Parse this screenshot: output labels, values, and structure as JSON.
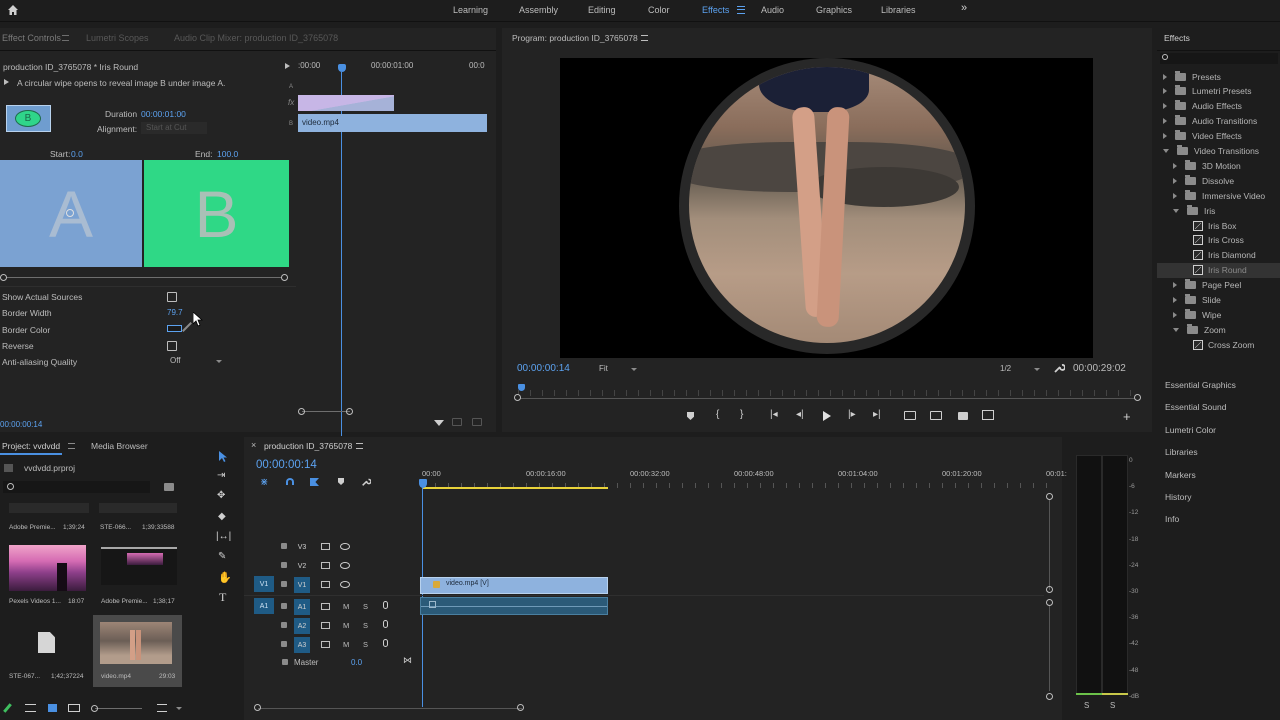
{
  "top_nav": {
    "home_icon": "home-icon",
    "items": [
      "Learning",
      "Assembly",
      "Editing",
      "Color",
      "Effects",
      "Audio",
      "Graphics",
      "Libraries"
    ],
    "active": "Effects",
    "more_icon": "double-chevron-right-icon"
  },
  "effect_controls": {
    "tabs": [
      "Effect Controls",
      "Lumetri Scopes",
      "Audio Clip Mixer: production ID_3765078"
    ],
    "clip_title": "production ID_3765078 * Iris Round",
    "description": "A circular wipe opens to reveal image B under image A.",
    "duration_label": "Duration",
    "duration_value": "00:00:01:00",
    "alignment_label": "Alignment:",
    "alignment_value": "Start at Cut",
    "start_label": "Start:",
    "start_value": "0.0",
    "end_label": "End:",
    "end_value": "100.0",
    "preview_a": "A",
    "preview_b": "B",
    "thumb_letter": "B",
    "props": [
      {
        "label": "Show Actual Sources"
      },
      {
        "label": "Border Width",
        "value": "79.7"
      },
      {
        "label": "Border Color"
      },
      {
        "label": "Reverse"
      },
      {
        "label": "Anti-aliasing Quality",
        "value": "Off"
      }
    ],
    "timecode": "00:00:00:14",
    "mini_timeline": {
      "t0": ":00:00",
      "t1": "00:00:01:00",
      "t2": "00:0",
      "track_a": "A",
      "track_b": "B",
      "clip": "video.mp4"
    }
  },
  "program": {
    "title": "Program: production ID_3765078",
    "timecode": "00:00:00:14",
    "fit": "Fit",
    "resolution": "1/2",
    "duration": "00:00:29:02",
    "border_color": "#2a2a2a"
  },
  "effects_panel": {
    "title": "Effects",
    "tree": [
      {
        "label": "Presets",
        "level": 0,
        "type": "folder",
        "open": false
      },
      {
        "label": "Lumetri Presets",
        "level": 0,
        "type": "folder",
        "open": false
      },
      {
        "label": "Audio Effects",
        "level": 0,
        "type": "folder",
        "open": false
      },
      {
        "label": "Audio Transitions",
        "level": 0,
        "type": "folder",
        "open": false
      },
      {
        "label": "Video Effects",
        "level": 0,
        "type": "folder",
        "open": false
      },
      {
        "label": "Video Transitions",
        "level": 0,
        "type": "folder",
        "open": true
      },
      {
        "label": "3D Motion",
        "level": 1,
        "type": "folder",
        "open": false
      },
      {
        "label": "Dissolve",
        "level": 1,
        "type": "folder",
        "open": false
      },
      {
        "label": "Immersive Video",
        "level": 1,
        "type": "folder",
        "open": false
      },
      {
        "label": "Iris",
        "level": 1,
        "type": "folder",
        "open": true
      },
      {
        "label": "Iris Box",
        "level": 2,
        "type": "fx"
      },
      {
        "label": "Iris Cross",
        "level": 2,
        "type": "fx"
      },
      {
        "label": "Iris Diamond",
        "level": 2,
        "type": "fx"
      },
      {
        "label": "Iris Round",
        "level": 2,
        "type": "fx",
        "selected": true
      },
      {
        "label": "Page Peel",
        "level": 1,
        "type": "folder",
        "open": false
      },
      {
        "label": "Slide",
        "level": 1,
        "type": "folder",
        "open": false
      },
      {
        "label": "Wipe",
        "level": 1,
        "type": "folder",
        "open": false
      },
      {
        "label": "Zoom",
        "level": 1,
        "type": "folder",
        "open": true
      },
      {
        "label": "Cross Zoom",
        "level": 2,
        "type": "fx"
      }
    ],
    "panels": [
      "Essential Graphics",
      "Essential Sound",
      "Lumetri Color",
      "Libraries",
      "Markers",
      "History",
      "Info"
    ]
  },
  "project": {
    "tabs": [
      "Project: vvdvdd",
      "Media Browser"
    ],
    "file": "vvdvdd.prproj",
    "items": [
      {
        "name": "Adobe Premie...",
        "duration": "1;39;24"
      },
      {
        "name": "STE-066...",
        "duration": "1;39;33588"
      },
      {
        "name": "Pexels Videos 1...",
        "duration": "18:07"
      },
      {
        "name": "Adobe Premie...",
        "duration": "1;38;17"
      },
      {
        "name": "STE-067...",
        "duration": "1;42;37224"
      },
      {
        "name": "video.mp4",
        "duration": "29:03"
      }
    ]
  },
  "timeline": {
    "sequence": "production ID_3765078",
    "timecode": "00:00:00:14",
    "ruler": [
      "00:00",
      "00:00:16:00",
      "00:00:32:00",
      "00:00:48:00",
      "00:01:04:00",
      "00:01:20:00",
      "00:01:"
    ],
    "video_tracks": [
      "V3",
      "V2",
      "V1"
    ],
    "audio_tracks": [
      "A1",
      "A2",
      "A3"
    ],
    "src_v": "V1",
    "src_a": "A1",
    "master_label": "Master",
    "master_value": "0.0",
    "clip_label": "video.mp4 [V]",
    "m_label": "M",
    "s_label": "S"
  },
  "meter": {
    "scale": [
      "0",
      "-6",
      "-12",
      "-18",
      "-24",
      "-30",
      "-36",
      "-42",
      "-48",
      "-dB"
    ],
    "solo": [
      "S",
      "S"
    ]
  }
}
